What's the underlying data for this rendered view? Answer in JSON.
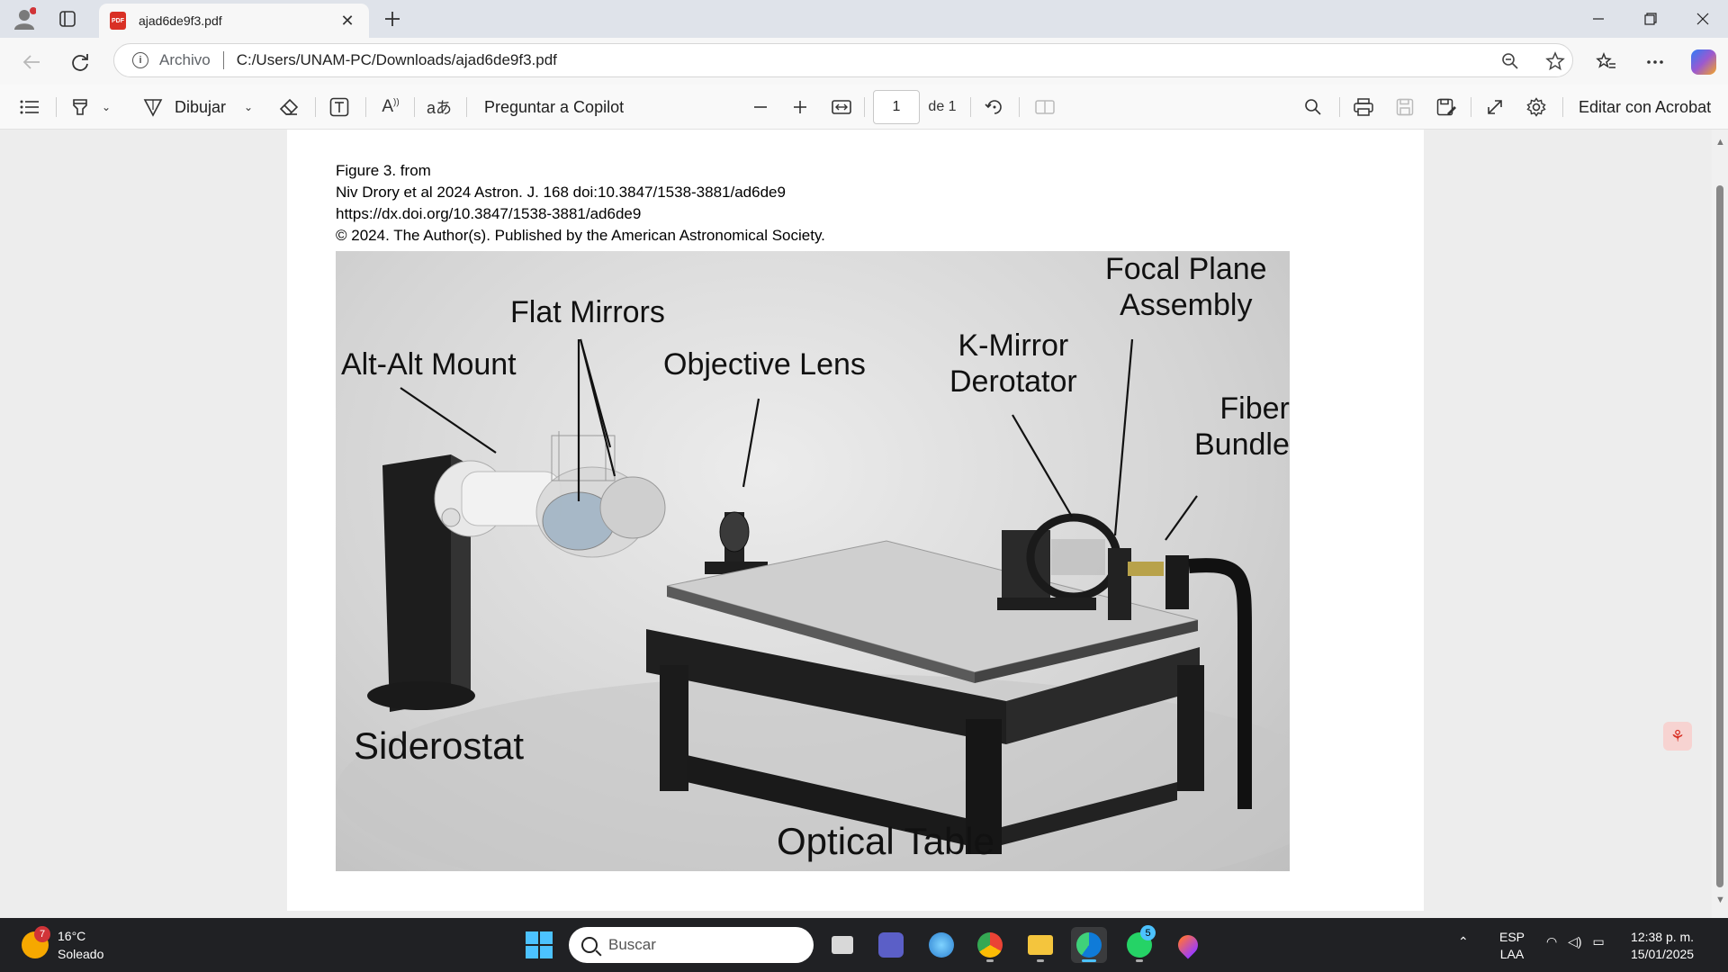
{
  "browser": {
    "tab_title": "ajad6de9f3.pdf",
    "pdf_icon_text": "PDF",
    "archivo_label": "Archivo",
    "url": "C:/Users/UNAM-PC/Downloads/ajad6de9f3.pdf"
  },
  "pdf_toolbar": {
    "draw_label": "Dibujar",
    "copilot_label": "Preguntar a Copilot",
    "page_current": "1",
    "page_of": "de 1",
    "acrobat_label": "Editar con Acrobat"
  },
  "document": {
    "caption_lines": [
      "Figure 3. from",
      "Niv Drory et al 2024 Astron. J. 168 doi:10.3847/1538-3881/ad6de9",
      "https://dx.doi.org/10.3847/1538-3881/ad6de9",
      "© 2024. The Author(s). Published by the American Astronomical Society."
    ],
    "figure_labels": {
      "alt_alt_mount": "Alt-Alt Mount",
      "flat_mirrors": "Flat Mirrors",
      "objective_lens": "Objective Lens",
      "k_mirror": "K-Mirror\nDerotator",
      "focal_plane": "Focal Plane\nAssembly",
      "fiber_bundle": "Fiber\nBundle",
      "siderostat": "Siderostat",
      "optical_table": "Optical Table"
    }
  },
  "taskbar": {
    "weather_temp": "16°C",
    "weather_desc": "Soleado",
    "weather_badge": "7",
    "search_placeholder": "Buscar",
    "whatsapp_badge": "5",
    "lang_line1": "ESP",
    "lang_line2": "LAA",
    "time": "12:38 p. m.",
    "date": "15/01/2025"
  },
  "colors": {
    "edge_accent": "#4cc2ff",
    "pdf_red": "#d93025",
    "taskbar_bg": "#202124"
  }
}
